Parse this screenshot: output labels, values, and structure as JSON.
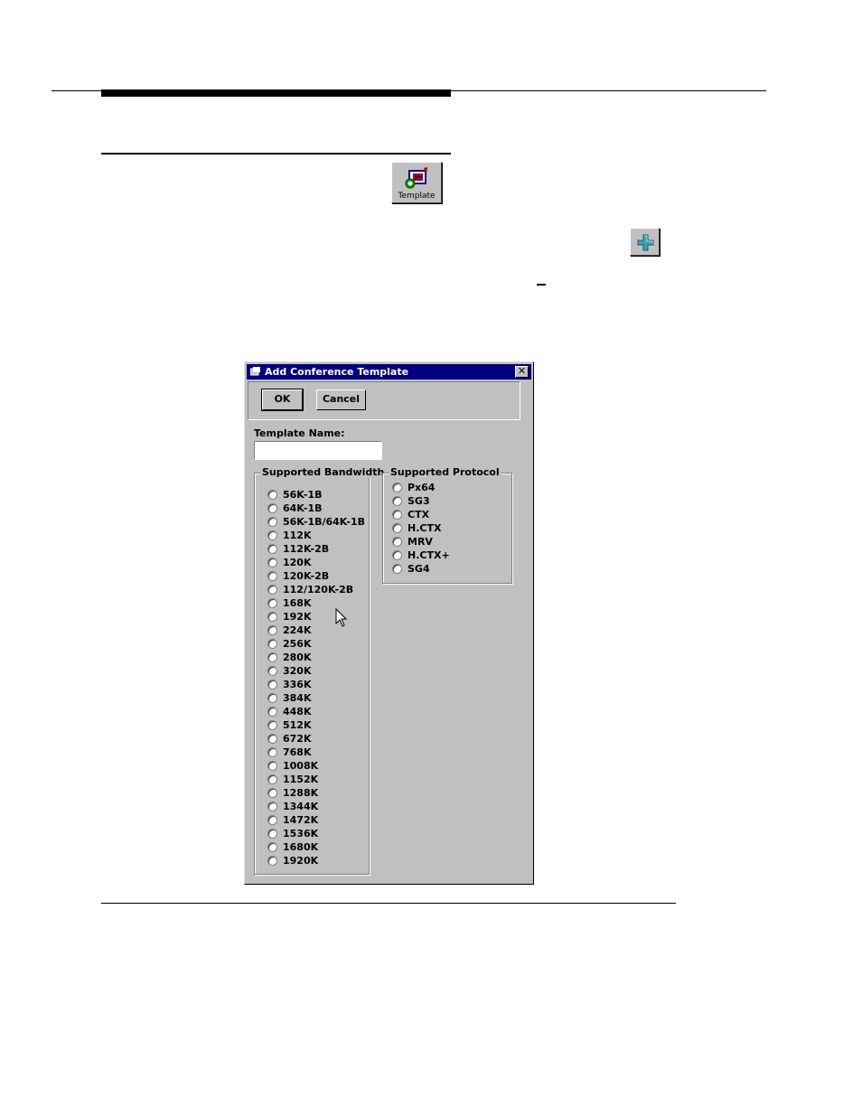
{
  "toolbar_icons": {
    "template_caption": "Template"
  },
  "dialog": {
    "title": "Add Conference Template",
    "close_glyph": "✕",
    "ok_label": "OK",
    "cancel_label": "Cancel",
    "template_name_label": "Template Name:",
    "template_name_value": "",
    "bandwidth_group_label": "Supported Bandwidth",
    "protocol_group_label": "Supported Protocol",
    "bandwidth_options": [
      "56K-1B",
      "64K-1B",
      "56K-1B/64K-1B",
      "112K",
      "112K-2B",
      "120K",
      "120K-2B",
      "112/120K-2B",
      "168K",
      "192K",
      "224K",
      "256K",
      "280K",
      "320K",
      "336K",
      "384K",
      "448K",
      "512K",
      "672K",
      "768K",
      "1008K",
      "1152K",
      "1288K",
      "1344K",
      "1472K",
      "1536K",
      "1680K",
      "1920K"
    ],
    "protocol_options": [
      "Px64",
      "SG3",
      "CTX",
      "H.CTX",
      "MRV",
      "H.CTX+",
      "SG4"
    ]
  },
  "colors": {
    "titlebar": "#000080",
    "dialog_face": "#c0c0c0",
    "add_icon": "#3aa0b8"
  },
  "icons": [
    "template-icon",
    "plus-icon",
    "dialog-app-icon",
    "close-icon",
    "mouse-pointer-icon"
  ]
}
